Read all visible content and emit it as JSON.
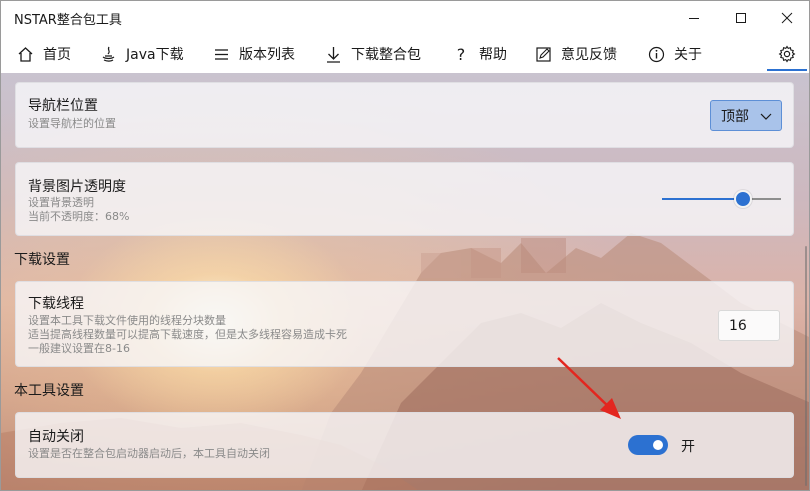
{
  "window": {
    "title": "NSTAR整合包工具",
    "controls": [
      "minimize-icon",
      "maximize-icon",
      "close-icon"
    ]
  },
  "nav": {
    "items": [
      {
        "label": "首页",
        "icon": "home-icon"
      },
      {
        "label": "Java下载",
        "icon": "java-icon"
      },
      {
        "label": "版本列表",
        "icon": "list-icon"
      },
      {
        "label": "下载整合包",
        "icon": "download-icon"
      },
      {
        "label": "帮助",
        "icon": "help-icon"
      },
      {
        "label": "意见反馈",
        "icon": "feedback-icon"
      },
      {
        "label": "关于",
        "icon": "info-icon"
      }
    ],
    "active": "settings",
    "accent": "#2c71d1"
  },
  "settings": {
    "nav_position": {
      "title": "导航栏位置",
      "desc": "设置导航栏的位置",
      "value": "顶部"
    },
    "bg_opacity": {
      "title": "背景图片透明度",
      "desc1": "设置背景透明",
      "desc2": "当前不透明度：68%",
      "value": 0.68
    },
    "download_section": "下载设置",
    "threads": {
      "title": "下载线程",
      "desc1": "设置本工具下载文件使用的线程分块数量",
      "desc2": "适当提高线程数量可以提高下载速度，但是太多线程容易造成卡死",
      "desc3": "一般建议设置在8-16",
      "value": "16"
    },
    "tool_section": "本工具设置",
    "auto_close": {
      "title": "自动关闭",
      "desc": "设置是否在整合包启动器启动后，本工具自动关闭",
      "state_label": "开",
      "enabled": true
    }
  }
}
